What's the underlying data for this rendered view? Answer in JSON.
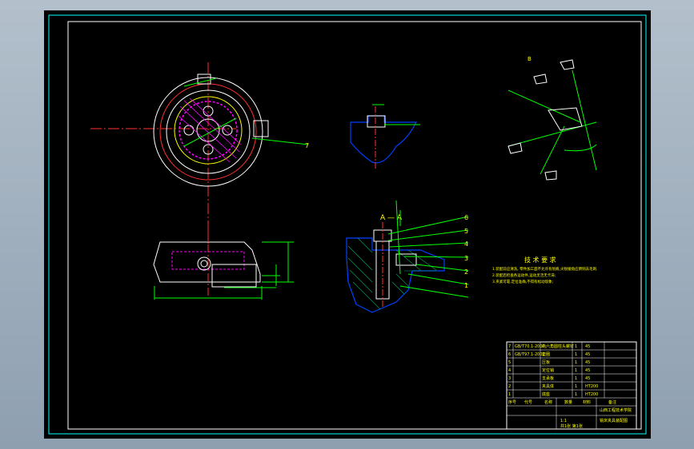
{
  "views": {
    "section_label": "A — A",
    "detail_label": "B",
    "top_label": "A"
  },
  "callouts": [
    "7",
    "6",
    "5",
    "4",
    "3",
    "2",
    "1"
  ],
  "tech_requirements": {
    "title": "技 术 要 求",
    "lines": [
      "1.装配前应清洗, 零件加工面不允许有划痕,尖锐棱角应倒钝去毛刺.",
      "2.装配后检查各运动件,运动灵活无卡滞;",
      "3.夹紧可靠,定位准确,不得有松动现象;"
    ]
  },
  "parts_list": {
    "rows": [
      {
        "no": "7",
        "code": "GB/T70.1-2000",
        "name": "内六角圆柱头螺钉",
        "qty": "1",
        "mat": "45"
      },
      {
        "no": "6",
        "code": "GB/T97.1-2002",
        "name": "垫圈",
        "qty": "1",
        "mat": "45"
      },
      {
        "no": "5",
        "code": "",
        "name": "压板",
        "qty": "1",
        "mat": "45"
      },
      {
        "no": "4",
        "code": "",
        "name": "定位销",
        "qty": "1",
        "mat": "45"
      },
      {
        "no": "3",
        "code": "",
        "name": "支承板",
        "qty": "1",
        "mat": "45"
      },
      {
        "no": "2",
        "code": "",
        "name": "夹具体",
        "qty": "1",
        "mat": "HT200"
      },
      {
        "no": "1",
        "code": "",
        "name": "底座",
        "qty": "1",
        "mat": "HT200"
      }
    ],
    "header": [
      "序号",
      "代号",
      "名称",
      "数量",
      "材料",
      "备注"
    ]
  },
  "title_block": {
    "school": "山西工程技术学院",
    "drawing_name": "铣床夹具装配图",
    "scale": "1:1",
    "sheet": "共1张 第1张"
  }
}
